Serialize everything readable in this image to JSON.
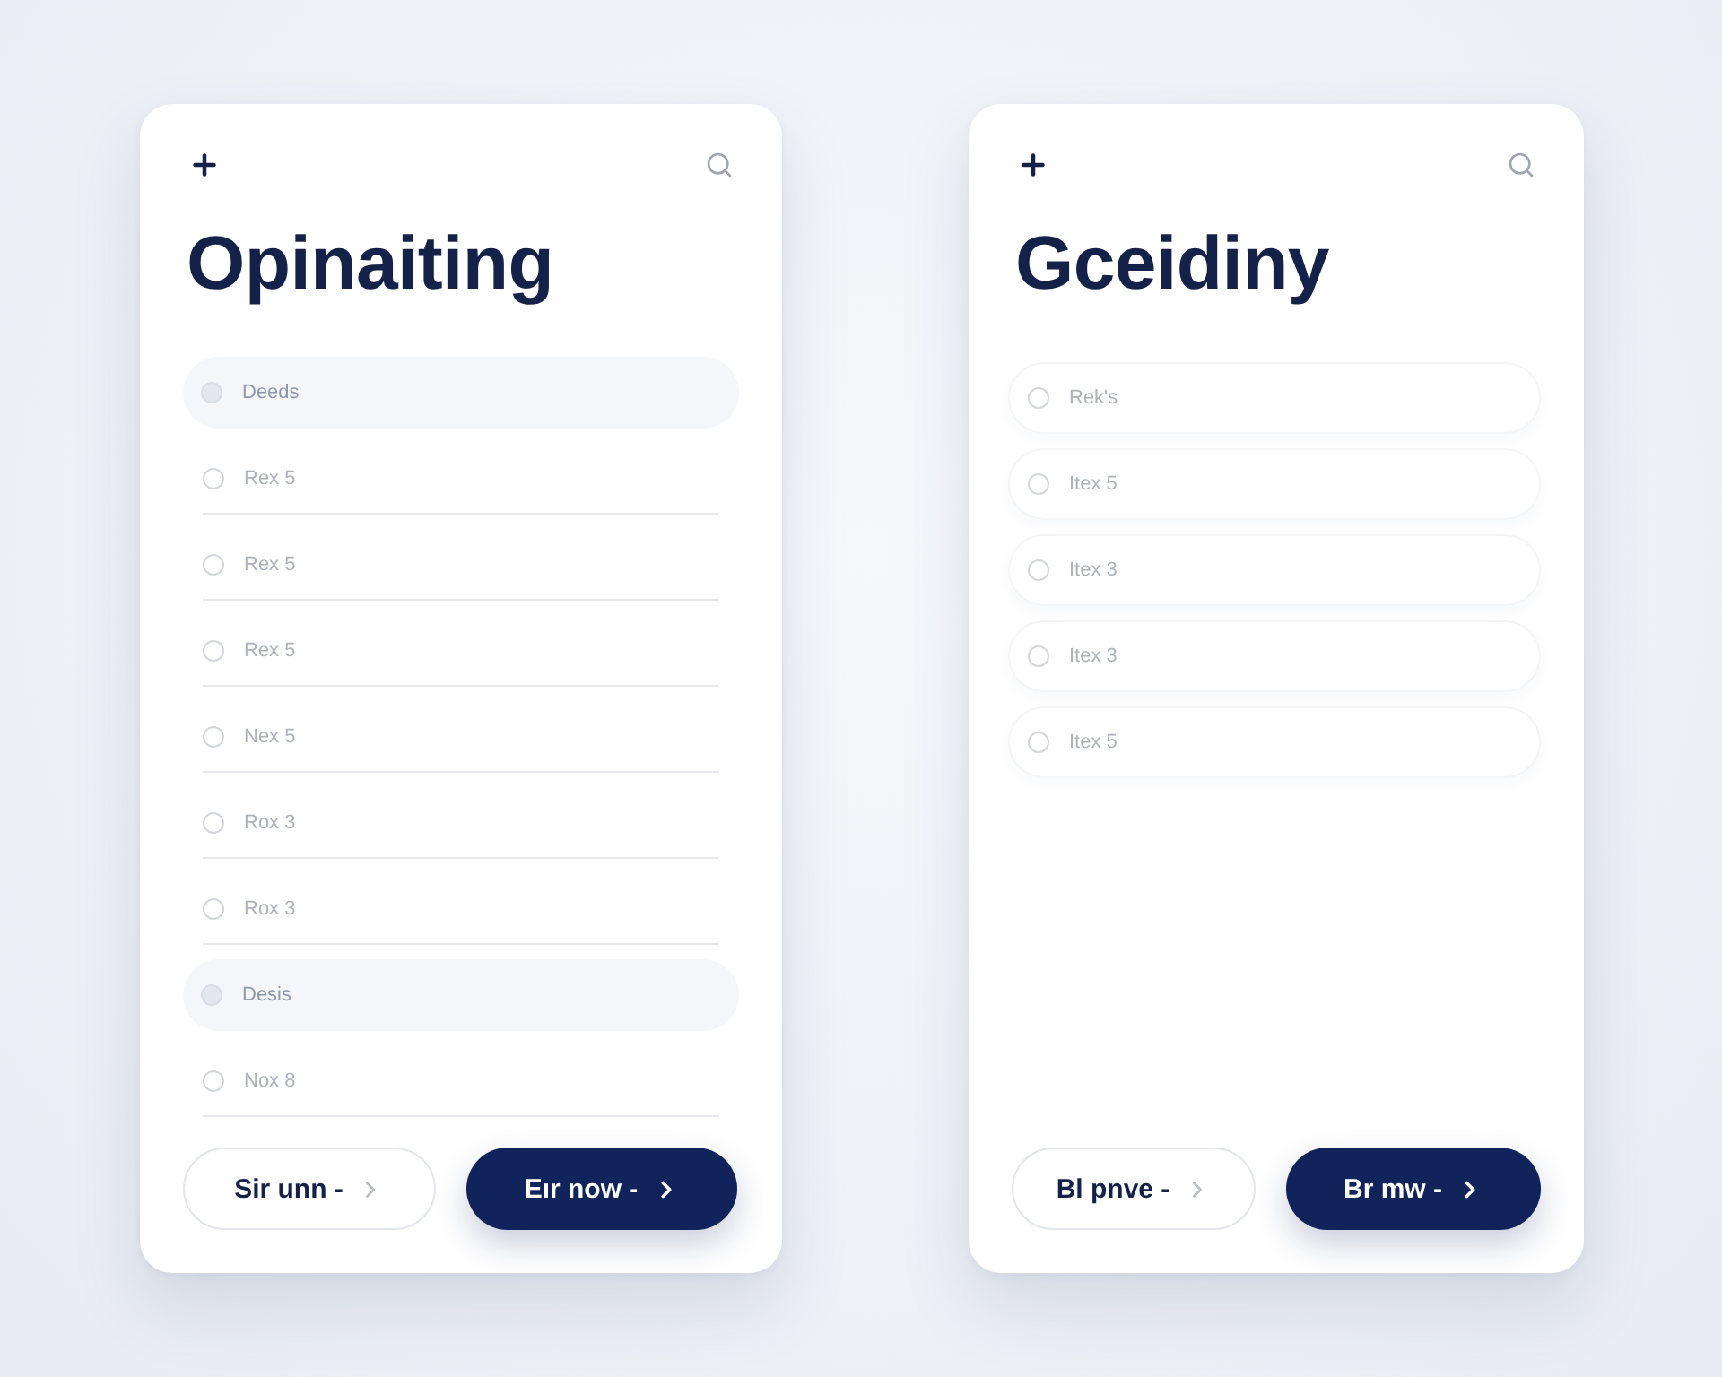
{
  "cards": [
    {
      "title": "Opinaiting",
      "kind": "divided",
      "items": [
        {
          "label": "Deeds",
          "selected": true
        },
        {
          "label": "Rex 5",
          "selected": false
        },
        {
          "label": "Rex 5",
          "selected": false
        },
        {
          "label": "Rex 5",
          "selected": false
        },
        {
          "label": "Nex 5",
          "selected": false
        },
        {
          "label": "Rox 3",
          "selected": false
        },
        {
          "label": "Rox 3",
          "selected": false
        },
        {
          "label": "Desis",
          "selected": true
        },
        {
          "label": "Nox 8",
          "selected": false
        }
      ],
      "buttons": [
        {
          "label": "Sir unn -",
          "kind": "outline"
        },
        {
          "label": "Eır now -",
          "kind": "filled"
        }
      ]
    },
    {
      "title": "Gceidiny",
      "kind": "tiled",
      "items": [
        {
          "label": "Rek's",
          "selected": false
        },
        {
          "label": "Itex 5",
          "selected": false
        },
        {
          "label": "Itex 3",
          "selected": false
        },
        {
          "label": "Itex 3",
          "selected": false
        },
        {
          "label": "Itex 5",
          "selected": false
        }
      ],
      "buttons": [
        {
          "label": "Bl pnve -",
          "kind": "outline"
        },
        {
          "label": "Br mw -",
          "kind": "filled"
        }
      ]
    }
  ]
}
